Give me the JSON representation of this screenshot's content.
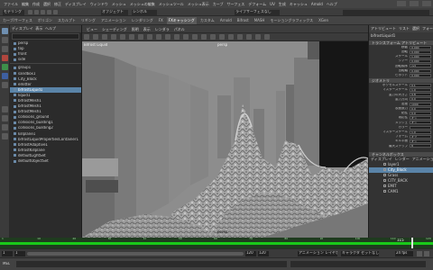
{
  "app": {
    "window_title": "Maya",
    "menus": [
      "ファイル",
      "編集",
      "作成",
      "選択",
      "修正",
      "ディスプレイ",
      "ウィンドウ",
      "メッシュ",
      "メッシュの編集",
      "メッシュツール",
      "メッシュ表示",
      "カーブ",
      "サーフェス",
      "デフォーム",
      "UV",
      "生成",
      "キャッシュ",
      "Arnold",
      "ヘルプ"
    ]
  },
  "status_line": {
    "mode": "モデリング",
    "fields": [
      "オブジェクト",
      "シンボル"
    ],
    "live_label": "ライブサーフェスなし"
  },
  "shelf": {
    "tabs": [
      "カーブ/サーフェス",
      "ポリゴン",
      "スカルプト",
      "リギング",
      "アニメーション",
      "レンダリング",
      "FX",
      "FXキャッシング",
      "カスタム",
      "Arnold",
      "Bifrost",
      "MASH",
      "モーショングラフィックス",
      "XGen"
    ],
    "active_tab": "FXキャッシング"
  },
  "outliner": {
    "menus": [
      "ディスプレイ",
      "表示",
      "ヘルプ"
    ],
    "items": [
      {
        "label": "persp",
        "selected": false
      },
      {
        "label": "top",
        "selected": false
      },
      {
        "label": "front",
        "selected": false
      },
      {
        "label": "side",
        "selected": false
      },
      {
        "label": "group1",
        "selected": false
      },
      {
        "label": "sandbox1",
        "selected": false
      },
      {
        "label": "City_Block",
        "selected": false
      },
      {
        "label": "emitter",
        "selected": false
      },
      {
        "label": "bifrostLiquid1",
        "selected": true
      },
      {
        "label": "liquid1",
        "selected": false
      },
      {
        "label": "bifrostMesh1",
        "selected": false
      },
      {
        "label": "bifrostMesh1",
        "selected": false
      },
      {
        "label": "bifrostMesh1",
        "selected": false
      },
      {
        "label": "collisions_ground",
        "selected": false
      },
      {
        "label": "collisions_building1",
        "selected": false
      },
      {
        "label": "collisions_building2",
        "selected": false
      },
      {
        "label": "killplane1",
        "selected": false
      },
      {
        "label": "bifrostLiquidPropertiesContainer1",
        "selected": false
      },
      {
        "label": "bifrostAdaptive1",
        "selected": false
      },
      {
        "label": "bifrostKillplane",
        "selected": false
      },
      {
        "label": "defaultLightSet",
        "selected": false
      },
      {
        "label": "defaultObjectSet",
        "selected": false
      }
    ]
  },
  "viewport": {
    "menus": [
      "ビュー",
      "シェーディング",
      "照明",
      "表示",
      "レンダラ",
      "パネル"
    ],
    "camera_label": "persp",
    "hud_left": "Bifrost Liquid",
    "hud_center": "persp"
  },
  "attribute_editor": {
    "tabs": [
      "アトリビュート",
      "リスト",
      "選択",
      "フォーカス",
      "アトリビュート",
      "表示",
      "ヘルプ"
    ],
    "node_name": "bifrostLiquid1",
    "section_transform": "トランスフォーム アトリビュート",
    "transform_fields": [
      {
        "label": "移動",
        "value": "0.000"
      },
      {
        "label": "回転",
        "value": "0.000"
      },
      {
        "label": "スケール",
        "value": "1.000"
      },
      {
        "label": "シアー",
        "value": "0.000"
      },
      {
        "label": "回転順序",
        "value": "xyz"
      },
      {
        "label": "回転軸",
        "value": "0.000"
      },
      {
        "label": "ピボット",
        "value": "0.000"
      }
    ],
    "section_shape": "ジオメトリ",
    "shape_fields": [
      {
        "label": "ボクセルスケール",
        "value": "0.1"
      },
      {
        "label": "マスタースケール",
        "value": "1.0"
      },
      {
        "label": "重力の大きさ",
        "value": "9.8"
      },
      {
        "label": "重力方向",
        "value": "0.0"
      },
      {
        "label": "密度",
        "value": "1000"
      },
      {
        "label": "表面張力",
        "value": "0.0"
      },
      {
        "label": "粘性",
        "value": "0.0"
      },
      {
        "label": "適応性",
        "value": "オン"
      },
      {
        "label": "メッシュ",
        "value": "オン"
      },
      {
        "label": "カラー",
        "value": ""
      },
      {
        "label": "マスタースケール",
        "value": "1.0"
      },
      {
        "label": "フォーム",
        "value": "オフ"
      },
      {
        "label": "キル平面",
        "value": "オン"
      },
      {
        "label": "最大ステップ",
        "value": "8"
      }
    ],
    "channel_box_title": "チャンネルボックス",
    "layer_tabs": [
      "ディスプレイ",
      "レンダー",
      "アニメーション"
    ],
    "layers": [
      {
        "label": "layer1",
        "selected": false
      },
      {
        "label": "City_Block",
        "selected": true
      },
      {
        "label": "Grass",
        "selected": false
      },
      {
        "label": "CITY_BACK",
        "selected": false
      },
      {
        "label": "EMIT",
        "selected": false
      },
      {
        "label": "CAM1",
        "selected": false
      }
    ]
  },
  "timeline": {
    "ticks": [
      "1",
      "10",
      "20",
      "30",
      "40",
      "50",
      "60",
      "70",
      "80",
      "90",
      "100",
      "110",
      "120"
    ],
    "current_frame": "115",
    "accent": "#19c919"
  },
  "range_slider": {
    "start": "1",
    "end": "120",
    "range_start": "1",
    "range_end": "120",
    "anim_layer": "アニメーション レイヤなし",
    "char_set": "キャラクタ セットなし",
    "fps": "24 fps"
  },
  "command_line": {
    "mel_label": "MEL",
    "value": ""
  }
}
